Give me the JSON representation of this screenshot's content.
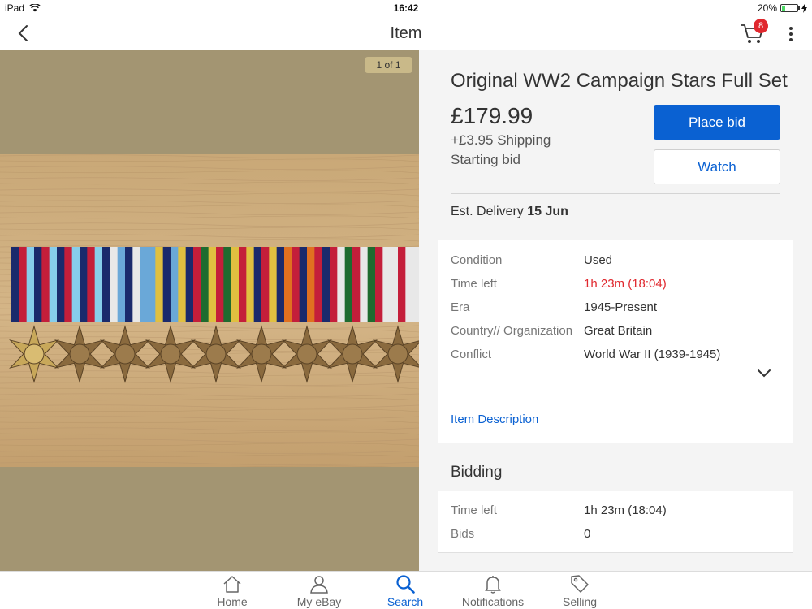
{
  "status_bar": {
    "device": "iPad",
    "time": "16:42",
    "battery": "20%",
    "battery_level": 0.2
  },
  "nav": {
    "title": "Item",
    "cart_count": "8",
    "icons": [
      "back-chevron-icon",
      "cart-icon",
      "more-vertical-icon"
    ]
  },
  "gallery": {
    "counter": "1 of 1"
  },
  "listing": {
    "title": "Original WW2 Campaign Stars Full Set",
    "price": "£179.99",
    "shipping": "+£3.95 Shipping",
    "bid_type": "Starting bid",
    "place_bid_label": "Place bid",
    "watch_label": "Watch",
    "delivery_label": "Est. Delivery",
    "delivery_date": "15 Jun"
  },
  "specifics": [
    {
      "key": "Condition",
      "value": "Used"
    },
    {
      "key": "Time left",
      "value": "1h 23m  (18:04)"
    },
    {
      "key": "Era",
      "value": "1945-Present"
    },
    {
      "key": "Country// Organization",
      "value": "Great Britain"
    },
    {
      "key": "Conflict",
      "value": "World War II (1939-1945)"
    }
  ],
  "item_description_link": "Item Description",
  "bidding": {
    "heading": "Bidding",
    "rows": [
      {
        "key": "Time left",
        "value": "1h 23m  (18:04)"
      },
      {
        "key": "Bids",
        "value": "0"
      }
    ]
  },
  "tabs": [
    {
      "label": "Home",
      "icon": "home-icon"
    },
    {
      "label": "My eBay",
      "icon": "person-icon"
    },
    {
      "label": "Search",
      "icon": "search-icon",
      "active": true
    },
    {
      "label": "Notifications",
      "icon": "bell-icon"
    },
    {
      "label": "Selling",
      "icon": "tag-icon"
    }
  ],
  "colors": {
    "accent": "#0a61d2",
    "alert": "#e0282e",
    "image_bg": "#a39572"
  }
}
